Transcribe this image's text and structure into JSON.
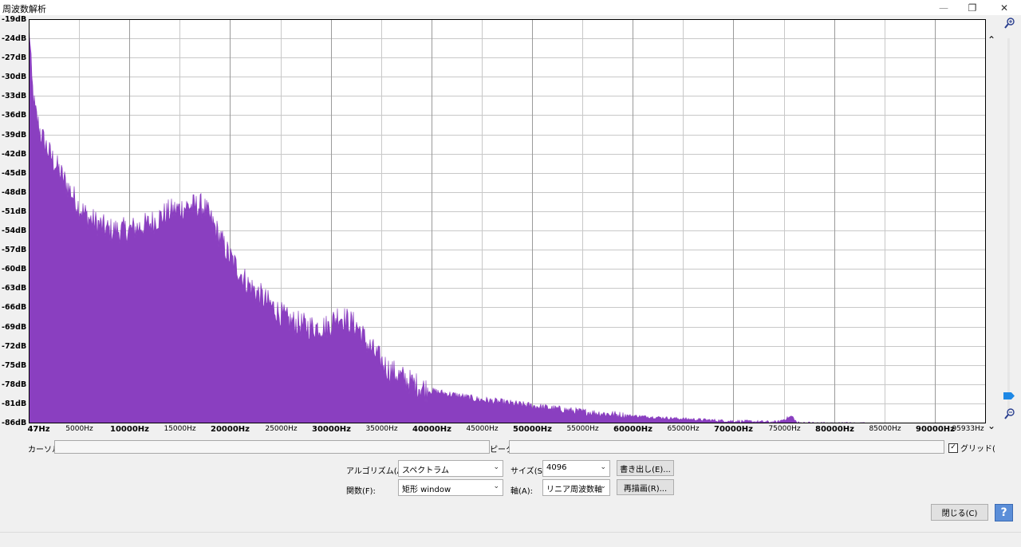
{
  "window": {
    "title": "周波数解析",
    "minimize": "—",
    "restore": "❐",
    "close": "✕"
  },
  "plot": {
    "fill_color": "#8a3fc0",
    "grid_color": "#c8c8c8",
    "y_labels": [
      "-19dB",
      "-24dB",
      "-27dB",
      "-30dB",
      "-33dB",
      "-36dB",
      "-39dB",
      "-42dB",
      "-45dB",
      "-48dB",
      "-51dB",
      "-54dB",
      "-57dB",
      "-60dB",
      "-63dB",
      "-66dB",
      "-69dB",
      "-72dB",
      "-75dB",
      "-78dB",
      "-81dB",
      "-86dB"
    ],
    "x_labels": [
      "47Hz",
      "5000Hz",
      "10000Hz",
      "15000Hz",
      "20000Hz",
      "25000Hz",
      "30000Hz",
      "35000Hz",
      "40000Hz",
      "45000Hz",
      "50000Hz",
      "55000Hz",
      "60000Hz",
      "65000Hz",
      "70000Hz",
      "75000Hz",
      "80000Hz",
      "85000Hz",
      "90000Hz",
      "95933Hz"
    ]
  },
  "spectrum": {
    "x_max_hz": 95933,
    "y_min_db": -86,
    "y_max_db": -19,
    "envelope": [
      [
        47,
        -20
      ],
      [
        300,
        -29
      ],
      [
        600,
        -34
      ],
      [
        1200,
        -38
      ],
      [
        2000,
        -41
      ],
      [
        3000,
        -44
      ],
      [
        4000,
        -47
      ],
      [
        5000,
        -50
      ],
      [
        6000,
        -52
      ],
      [
        8000,
        -54
      ],
      [
        10000,
        -54
      ],
      [
        12000,
        -53
      ],
      [
        14000,
        -51
      ],
      [
        16000,
        -50
      ],
      [
        17500,
        -50
      ],
      [
        18500,
        -53
      ],
      [
        20000,
        -58
      ],
      [
        22000,
        -63
      ],
      [
        24000,
        -66
      ],
      [
        26000,
        -69
      ],
      [
        28000,
        -70
      ],
      [
        30000,
        -70
      ],
      [
        31000,
        -68
      ],
      [
        32000,
        -69
      ],
      [
        33000,
        -70
      ],
      [
        34000,
        -73
      ],
      [
        36000,
        -77
      ],
      [
        38000,
        -79
      ],
      [
        40000,
        -80.5
      ],
      [
        45000,
        -82
      ],
      [
        50000,
        -83
      ],
      [
        55000,
        -84
      ],
      [
        60000,
        -84.7
      ],
      [
        65000,
        -85.2
      ],
      [
        70000,
        -85.6
      ],
      [
        75000,
        -85.8
      ],
      [
        76500,
        -84.8
      ],
      [
        77000,
        -85.9
      ],
      [
        80000,
        -86
      ],
      [
        84000,
        -86
      ],
      [
        85000,
        -86.5
      ],
      [
        95933,
        -86.5
      ]
    ]
  },
  "zoom": {
    "zoom_in_icon": "zoom-in-icon",
    "zoom_out_icon": "zoom-out-icon",
    "up_arrow": "⌃",
    "down_arrow": "⌄"
  },
  "readout": {
    "cursor_label": "カーソル:",
    "peak_label": "ピーク:",
    "grid_label": "グリッド(",
    "grid_checked": true
  },
  "controls": {
    "algorithm_label": "アルゴリズム(A):",
    "algorithm_value": "スペクトラム",
    "size_label": "サイズ(S):",
    "size_value": "4096",
    "export_button": "書き出し(E)...",
    "function_label": "関数(F):",
    "function_value": "矩形 window",
    "axis_label": "軸(A):",
    "axis_value": "リニア周波数軸",
    "redraw_button": "再描画(R)...",
    "close_button": "閉じる(C)",
    "help_button": "?"
  },
  "colors": {
    "accent": "#1e88e5",
    "help_bg": "#5b8ed8"
  }
}
